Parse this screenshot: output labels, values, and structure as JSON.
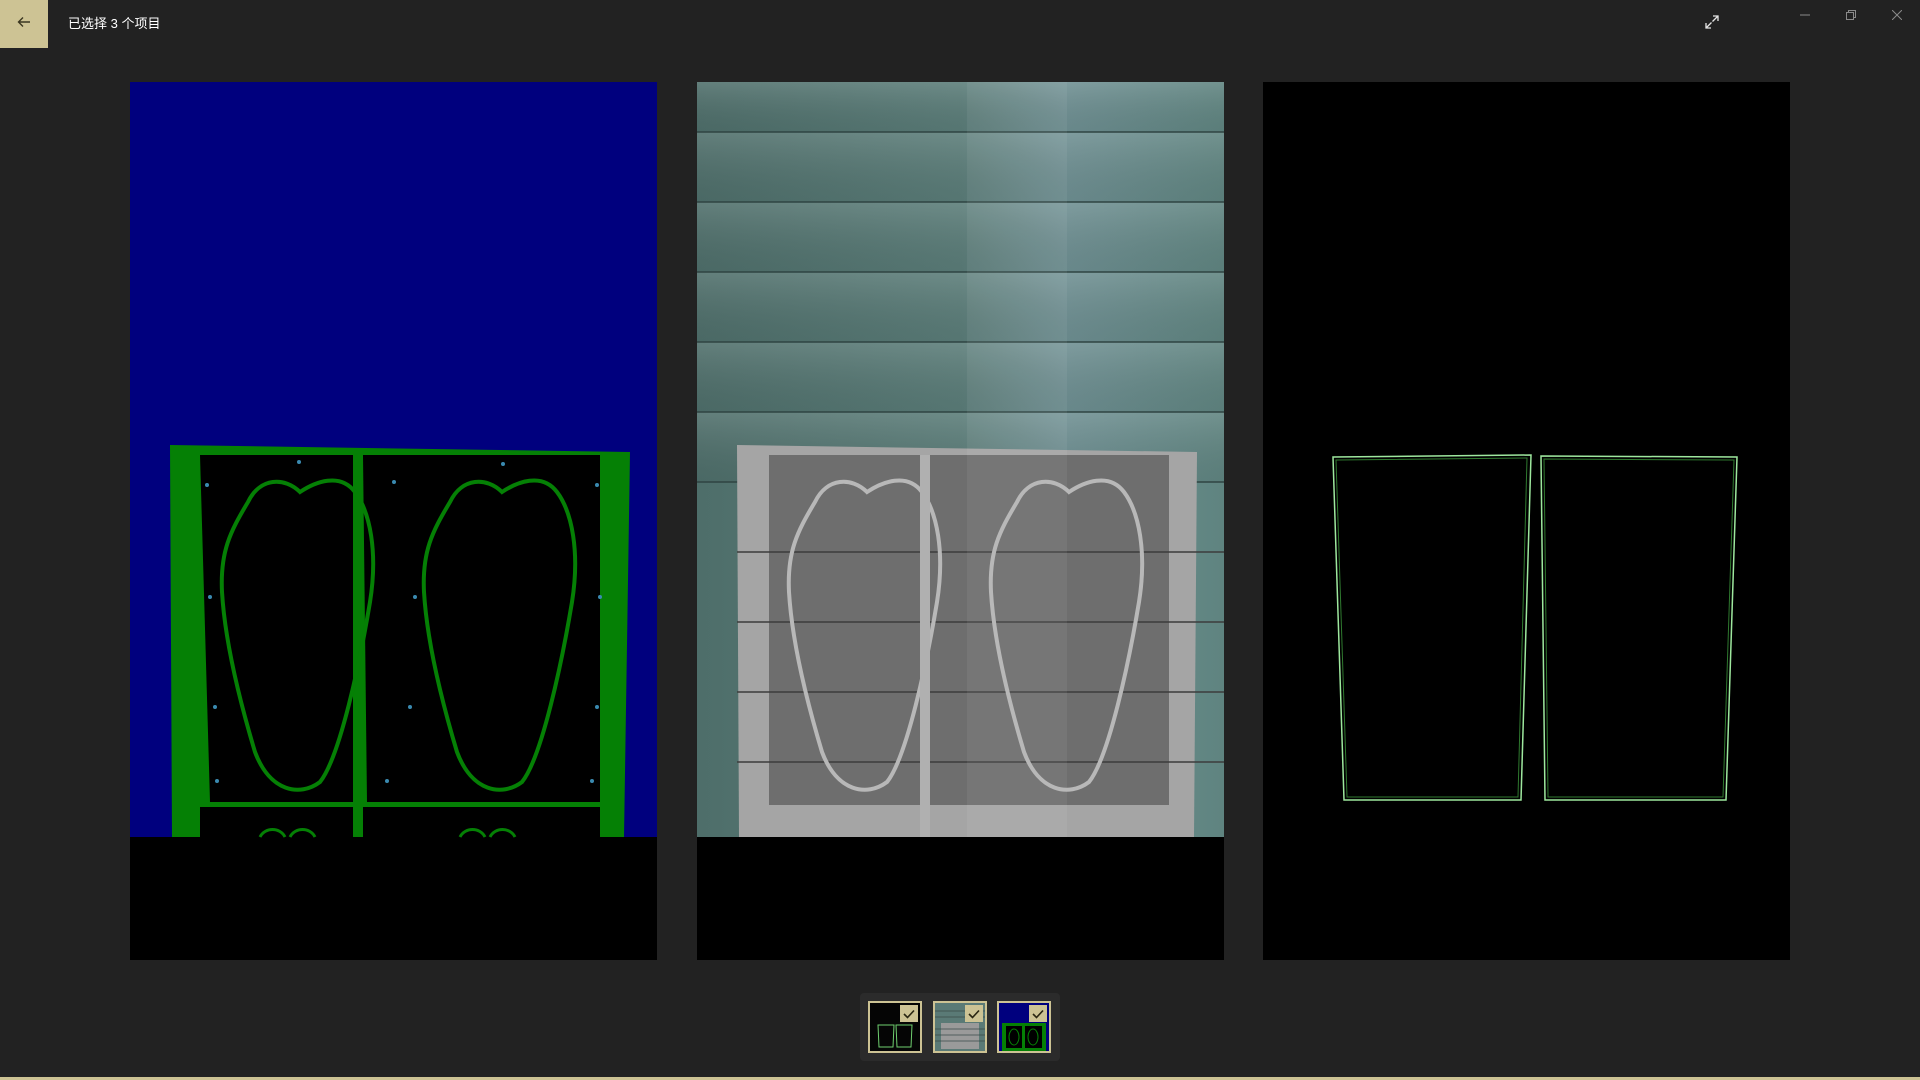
{
  "window": {
    "title": "已选择 3 个项目"
  },
  "icons": {
    "back": "back-arrow-icon",
    "expand": "expand-icon",
    "minimize": "minimize-icon",
    "restore": "restore-icon",
    "close": "close-icon",
    "check": "checkmark-icon"
  },
  "colors": {
    "accent": "#cdc394",
    "background": "#222222",
    "mask_blue": "#00007e",
    "mask_green": "#058005",
    "outline_green": "#9ee89e"
  },
  "selection": {
    "selected_count": 3,
    "thumbnails": [
      {
        "name": "outline-image",
        "selected": true
      },
      {
        "name": "scan-image",
        "selected": true
      },
      {
        "name": "mask-image",
        "selected": true
      }
    ]
  }
}
